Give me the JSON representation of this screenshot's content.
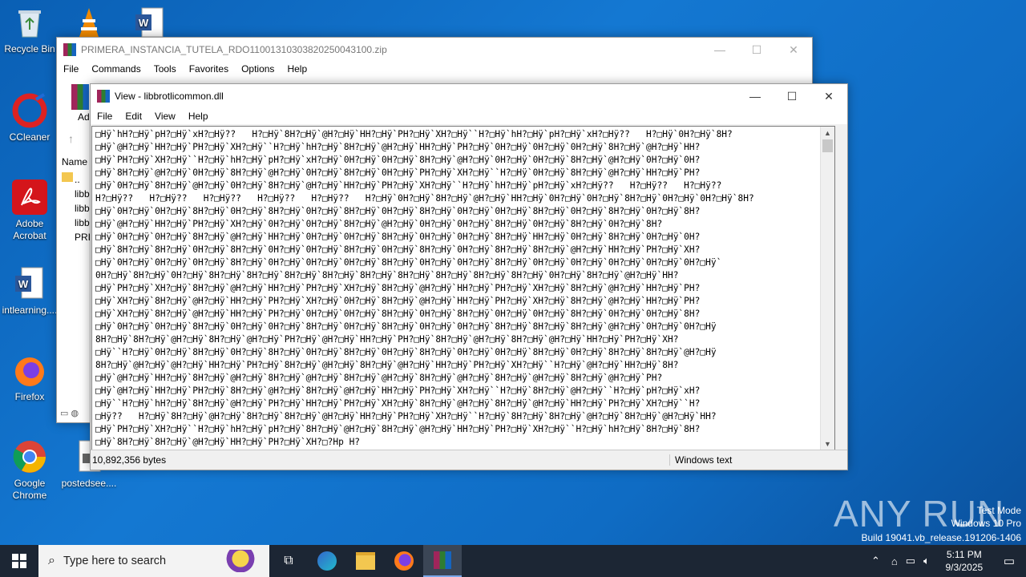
{
  "desktop": {
    "icons": [
      {
        "label": "Recycle Bin"
      },
      {
        "label": "CCleaner"
      },
      {
        "label": "Adobe Acrobat"
      },
      {
        "label": "intlearning...."
      },
      {
        "label": "Firefox"
      },
      {
        "label": "Google Chrome"
      },
      {
        "label": "postedsee...."
      }
    ],
    "watermark": {
      "brand": "ANY RUN",
      "mode": "Test Mode",
      "os": "Windows 10 Pro",
      "build": "Build 19041.vb_release.191206-1406"
    }
  },
  "winrar": {
    "title": "PRIMERA_INSTANCIA_TUTELA_RDO11001310303820250043100.zip",
    "menu": [
      "File",
      "Commands",
      "Tools",
      "Favorites",
      "Options",
      "Help"
    ],
    "toolbar_label": "Ad",
    "list_header": "Name",
    "rows": [
      "..",
      "libb",
      "libb",
      "libb",
      "PRI"
    ]
  },
  "viewer": {
    "title": "View - libbrotlicommon.dll",
    "menu": [
      "File",
      "Edit",
      "View",
      "Help"
    ],
    "lines": [
      "□Hÿ`hH?□Hÿ`pH?□Hÿ`xH?□Hÿ??   H?□Hÿ`8H?□Hÿ`@H?□Hÿ`HH?□Hÿ`PH?□Hÿ`XH?□Hÿ``H?□Hÿ`hH?□Hÿ`pH?□Hÿ`xH?□Hÿ??   H?□Hÿ`0H?□Hÿ`8H?",
      "□Hÿ`@H?□Hÿ`HH?□Hÿ`PH?□Hÿ`XH?□Hÿ``H?□Hÿ`hH?□Hÿ`8H?□Hÿ`@H?□Hÿ`HH?□Hÿ`PH?□Hÿ`0H?□Hÿ`0H?□Hÿ`0H?□Hÿ`8H?□Hÿ`@H?□Hÿ`HH?",
      "□Hÿ`PH?□Hÿ`XH?□Hÿ``H?□Hÿ`hH?□Hÿ`pH?□Hÿ`xH?□Hÿ`0H?□Hÿ`0H?□Hÿ`8H?□Hÿ`@H?□Hÿ`0H?□Hÿ`0H?□Hÿ`8H?□Hÿ`@H?□Hÿ`0H?□Hÿ`0H?",
      "□Hÿ`8H?□Hÿ`@H?□Hÿ`0H?□Hÿ`8H?□Hÿ`@H?□Hÿ`0H?□Hÿ`8H?□Hÿ`0H?□Hÿ`PH?□Hÿ`XH?□Hÿ``H?□Hÿ`0H?□Hÿ`8H?□Hÿ`@H?□Hÿ`HH?□Hÿ`PH?",
      "□Hÿ`0H?□Hÿ`8H?□Hÿ`@H?□Hÿ`0H?□Hÿ`8H?□Hÿ`@H?□Hÿ`HH?□Hÿ`PH?□Hÿ`XH?□Hÿ``H?□Hÿ`hH?□Hÿ`pH?□Hÿ`xH?□Hÿ??   H?□Hÿ??   H?□Hÿ??",
      "H?□Hÿ??   H?□Hÿ??   H?□Hÿ??   H?□Hÿ??   H?□Hÿ??   H?□Hÿ`0H?□Hÿ`8H?□Hÿ`@H?□Hÿ`HH?□Hÿ`0H?□Hÿ`0H?□Hÿ`8H?□Hÿ`0H?□Hÿ`0H?□Hÿ`8H?",
      "□Hÿ`0H?□Hÿ`0H?□Hÿ`8H?□Hÿ`0H?□Hÿ`8H?□Hÿ`0H?□Hÿ`8H?□Hÿ`0H?□Hÿ`8H?□Hÿ`0H?□Hÿ`0H?□Hÿ`8H?□Hÿ`0H?□Hÿ`8H?□Hÿ`0H?□Hÿ`8H?",
      "□Hÿ`@H?□Hÿ`HH?□Hÿ`PH?□Hÿ`XH?□Hÿ`0H?□Hÿ`0H?□Hÿ`8H?□Hÿ`@H?□Hÿ`0H?□Hÿ`0H?□Hÿ`8H?□Hÿ`0H?□Hÿ`8H?□Hÿ`0H?□Hÿ`8H?",
      "□Hÿ`0H?□Hÿ`0H?□Hÿ`8H?□Hÿ`@H?□Hÿ`HH?□Hÿ`0H?□Hÿ`0H?□Hÿ`8H?□Hÿ`0H?□Hÿ`0H?□Hÿ`8H?□Hÿ`HH?□Hÿ`0H?□Hÿ`8H?□Hÿ`0H?□Hÿ`0H?",
      "□Hÿ`8H?□Hÿ`8H?□Hÿ`0H?□Hÿ`8H?□Hÿ`0H?□Hÿ`0H?□Hÿ`8H?□Hÿ`0H?□Hÿ`8H?□Hÿ`0H?□Hÿ`8H?□Hÿ`8H?□Hÿ`@H?□Hÿ`HH?□Hÿ`PH?□Hÿ`XH?",
      "□Hÿ`0H?□Hÿ`0H?□Hÿ`0H?□Hÿ`8H?□Hÿ`0H?□Hÿ`0H?□Hÿ`0H?□Hÿ`8H?□Hÿ`0H?□Hÿ`0H?□Hÿ`8H?□Hÿ`0H?□Hÿ`0H?□Hÿ`0H?□Hÿ`0H?□Hÿ`0H?□Hÿ`",
      "0H?□Hÿ`8H?□Hÿ`0H?□Hÿ`8H?□Hÿ`8H?□Hÿ`8H?□Hÿ`8H?□Hÿ`8H?□Hÿ`8H?□Hÿ`8H?□Hÿ`8H?□Hÿ`8H?□Hÿ`0H?□Hÿ`8H?□Hÿ`@H?□Hÿ`HH?",
      "□Hÿ`PH?□Hÿ`XH?□Hÿ`8H?□Hÿ`@H?□Hÿ`HH?□Hÿ`PH?□Hÿ`XH?□Hÿ`8H?□Hÿ`@H?□Hÿ`HH?□Hÿ`PH?□Hÿ`XH?□Hÿ`8H?□Hÿ`@H?□Hÿ`HH?□Hÿ`PH?",
      "□Hÿ`XH?□Hÿ`8H?□Hÿ`@H?□Hÿ`HH?□Hÿ`PH?□Hÿ`XH?□Hÿ`0H?□Hÿ`8H?□Hÿ`@H?□Hÿ`HH?□Hÿ`PH?□Hÿ`XH?□Hÿ`8H?□Hÿ`@H?□Hÿ`HH?□Hÿ`PH?",
      "□Hÿ`XH?□Hÿ`8H?□Hÿ`@H?□Hÿ`HH?□Hÿ`PH?□Hÿ`0H?□Hÿ`0H?□Hÿ`8H?□Hÿ`0H?□Hÿ`8H?□Hÿ`0H?□Hÿ`0H?□Hÿ`8H?□Hÿ`0H?□Hÿ`0H?□Hÿ`8H?",
      "□Hÿ`0H?□Hÿ`0H?□Hÿ`8H?□Hÿ`0H?□Hÿ`0H?□Hÿ`8H?□Hÿ`0H?□Hÿ`8H?□Hÿ`0H?□Hÿ`0H?□Hÿ`8H?□Hÿ`8H?□Hÿ`8H?□Hÿ`@H?□Hÿ`0H?□Hÿ`0H?□Hÿ",
      "8H?□Hÿ`8H?□Hÿ`@H?□Hÿ`8H?□Hÿ`@H?□Hÿ`PH?□Hÿ`@H?□Hÿ`HH?□Hÿ`PH?□Hÿ`8H?□Hÿ`@H?□Hÿ`8H?□Hÿ`@H?□Hÿ`HH?□Hÿ`PH?□Hÿ`XH?",
      "□Hÿ``H?□Hÿ`0H?□Hÿ`8H?□Hÿ`0H?□Hÿ`8H?□Hÿ`0H?□Hÿ`8H?□Hÿ`0H?□Hÿ`8H?□Hÿ`0H?□Hÿ`0H?□Hÿ`8H?□Hÿ`0H?□Hÿ`8H?□Hÿ`8H?□Hÿ`@H?□Hÿ",
      "8H?□Hÿ`@H?□Hÿ`@H?□Hÿ`HH?□Hÿ`PH?□Hÿ`8H?□Hÿ`@H?□Hÿ`8H?□Hÿ`@H?□Hÿ`HH?□Hÿ`PH?□Hÿ`XH?□Hÿ``H?□Hÿ`@H?□Hÿ`HH?□Hÿ`8H?",
      "□Hÿ`@H?□Hÿ`HH?□Hÿ`8H?□Hÿ`@H?□Hÿ`8H?□Hÿ`@H?□Hÿ`8H?□Hÿ`@H?□Hÿ`8H?□Hÿ`@H?□Hÿ`8H?□Hÿ`@H?□Hÿ`8H?□Hÿ`@H?□Hÿ`PH?",
      "□Hÿ`@H?□Hÿ`HH?□Hÿ`PH?□Hÿ`8H?□Hÿ`@H?□Hÿ`8H?□Hÿ`@H?□Hÿ`HH?□Hÿ`PH?□Hÿ`XH?□Hÿ``H?□Hÿ`8H?□Hÿ`@H?□Hÿ``H?□Hÿ`pH?□Hÿ`xH?",
      "□Hÿ``H?□Hÿ`hH?□Hÿ`8H?□Hÿ`@H?□Hÿ`PH?□Hÿ`HH?□Hÿ`PH?□Hÿ`XH?□Hÿ`8H?□Hÿ`@H?□Hÿ`8H?□Hÿ`@H?□Hÿ`HH?□Hÿ`PH?□Hÿ`XH?□Hÿ``H?",
      "□Hÿ??   H?□Hÿ`8H?□Hÿ`@H?□Hÿ`8H?□Hÿ`8H?□Hÿ`@H?□Hÿ`HH?□Hÿ`PH?□Hÿ`XH?□Hÿ``H?□Hÿ`8H?□Hÿ`8H?□Hÿ`@H?□Hÿ`8H?□Hÿ`@H?□Hÿ`HH?",
      "□Hÿ`PH?□Hÿ`XH?□Hÿ``H?□Hÿ`hH?□Hÿ`pH?□Hÿ`8H?□Hÿ`@H?□Hÿ`8H?□Hÿ`@H?□Hÿ`HH?□Hÿ`PH?□Hÿ`XH?□Hÿ``H?□Hÿ`hH?□Hÿ`8H?□Hÿ`8H?",
      "□Hÿ`8H?□Hÿ`8H?□Hÿ`@H?□Hÿ`HH?□Hÿ`PH?□Hÿ`XH?□?Hp H?"
    ],
    "status_size": "10,892,356 bytes",
    "status_encoding": "Windows text"
  },
  "taskbar": {
    "search_placeholder": "Type here to search",
    "time": "5:11 PM",
    "date": "9/3/2025"
  }
}
